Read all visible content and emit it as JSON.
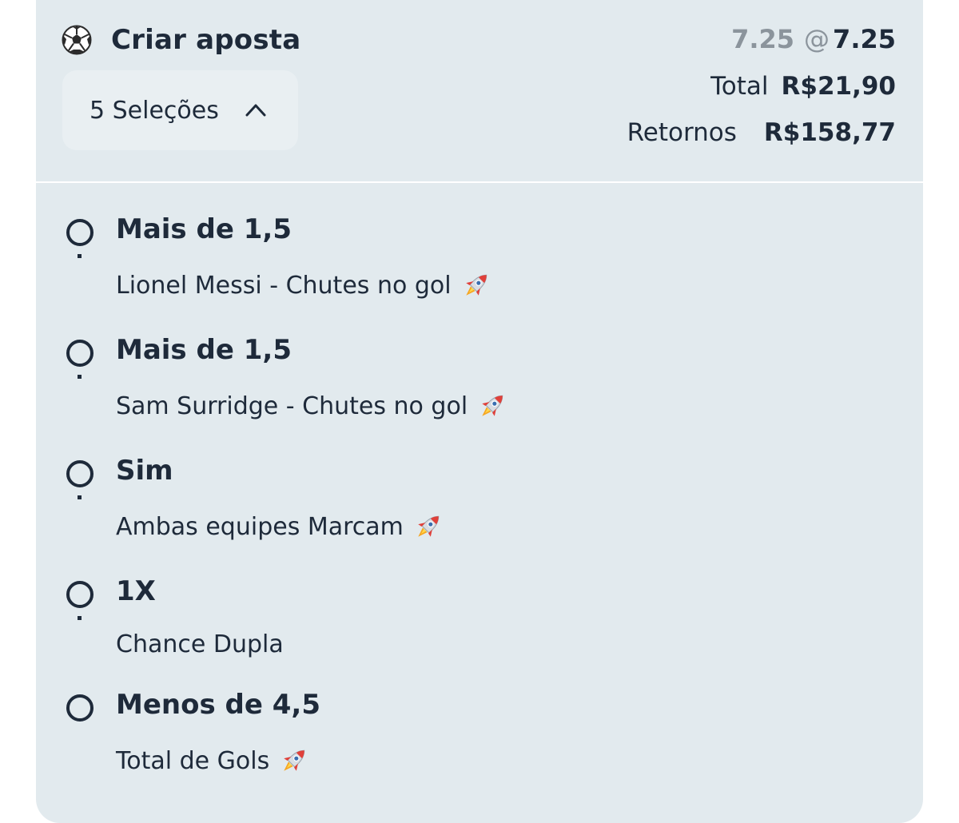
{
  "header": {
    "title": "Criar aposta",
    "selections_label": "5 Seleções",
    "odds_old": "7.25",
    "odds_separator": "@",
    "odds_new": "7.25",
    "total_label": "Total",
    "total_value": "R$21,90",
    "returns_label": "Retornos",
    "returns_value": "R$158,77"
  },
  "selections": [
    {
      "title": "Mais de 1,5",
      "subtitle": "Lionel Messi - Chutes no gol",
      "icon": "rocket-icon",
      "has_rocket": true
    },
    {
      "title": "Mais de 1,5",
      "subtitle": "Sam Surridge - Chutes no gol",
      "icon": "rocket-icon",
      "has_rocket": true
    },
    {
      "title": "Sim",
      "subtitle": "Ambas equipes Marcam",
      "icon": "rocket-icon",
      "has_rocket": true
    },
    {
      "title": "1X",
      "subtitle": "Chance Dupla",
      "has_rocket": false
    },
    {
      "title": "Menos de 4,5",
      "subtitle": "Total de Gols",
      "icon": "rocket-icon",
      "has_rocket": true
    }
  ],
  "colors": {
    "card_bg": "#e2eaee",
    "text": "#1e2a3a",
    "muted": "#8b949c"
  }
}
